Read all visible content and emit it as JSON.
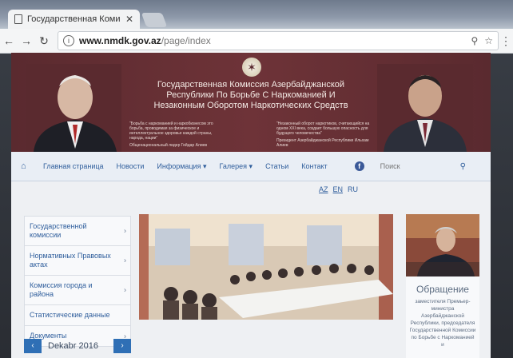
{
  "browser": {
    "tab_title": "Государственная Комис",
    "tab_close": "✕",
    "url_host": "www.nmdk.gov.az",
    "url_path": "/page/index"
  },
  "banner": {
    "title": "Государственная Комиссия Азербайджанской Республики По Борьбе С Наркоманией И Незаконным Оборотом Наркотических Средств",
    "quote_left": "“Борьба с наркоманией и наркобизнесом это борьба, проводимая за физическое и интеллектуальное здоровье каждой страны, народа, нации”",
    "quote_left_sig": "Общенациональный лидер Гейдар Алиев",
    "quote_right": "“Незаконный оборот наркотиков, считающийся на одном XXI века, создает большую опасность для будущего человечества”",
    "quote_right_sig": "Президент Азербайджанской Республики Ильхам Алиев"
  },
  "nav": {
    "items": [
      {
        "label": "Главная страница"
      },
      {
        "label": "Новости"
      },
      {
        "label": "Информация ▾"
      },
      {
        "label": "Галерея ▾"
      },
      {
        "label": "Статьи"
      },
      {
        "label": "Контакт"
      }
    ],
    "facebook": "f",
    "search_placeholder": "Поиск"
  },
  "languages": [
    "AZ",
    "EN",
    "RU"
  ],
  "sidebar": {
    "items": [
      {
        "label": "Государственной комиссии"
      },
      {
        "label": "Нормативных Правовых актах"
      },
      {
        "label": "Комиссия города и района"
      },
      {
        "label": "Статистические данные"
      },
      {
        "label": "Документы"
      }
    ]
  },
  "aside": {
    "title": "Обращение",
    "text": "заместителя Премьер-министра Азербайджанской Республики, председателя Государственной Комиссии по Борьбе с Наркоманией и"
  },
  "calendar": {
    "month": "Dekabr 2016",
    "prev": "‹",
    "next": "›"
  },
  "colors": {
    "banner": "#6e3338",
    "link": "#2f5e9c",
    "button": "#2f6fb5"
  }
}
